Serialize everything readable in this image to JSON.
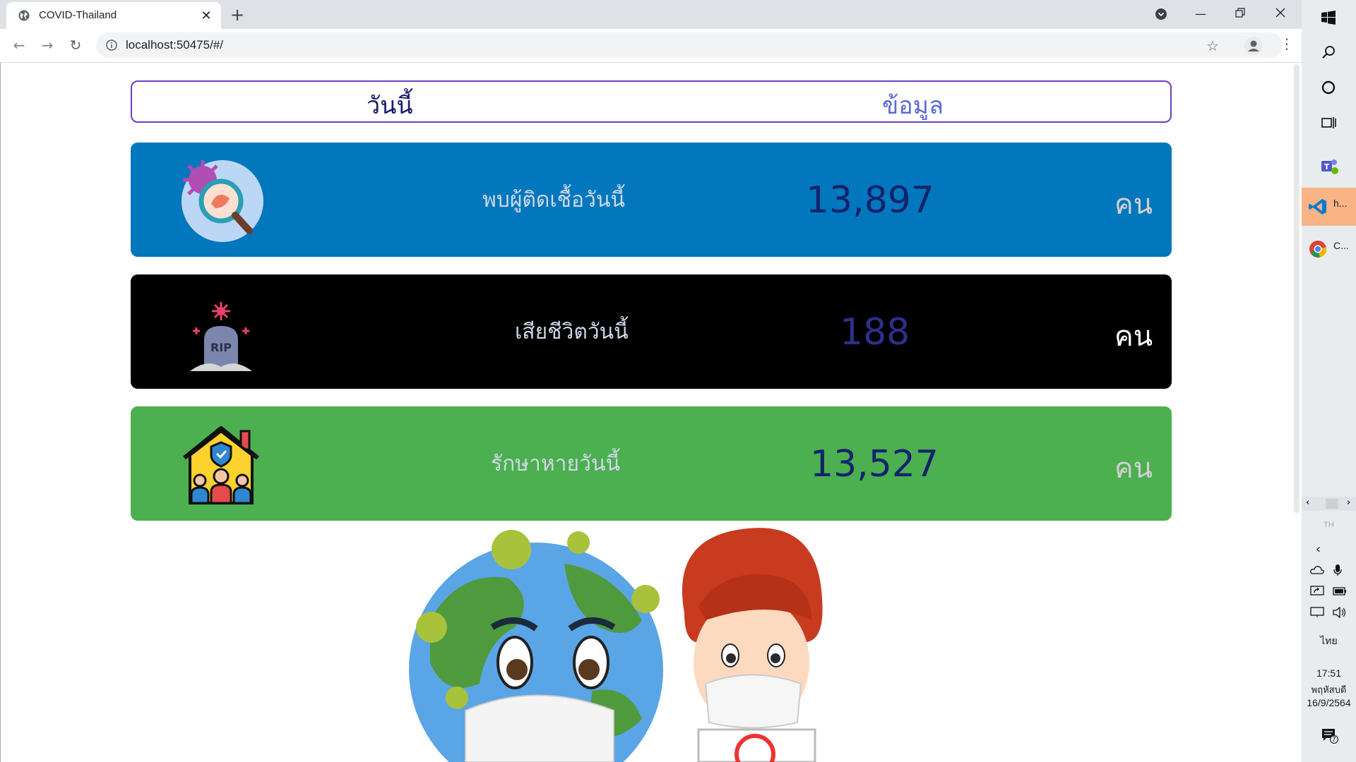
{
  "browser": {
    "tab_title": "COVID-Thailand",
    "new_tab_label": "+",
    "close_label": "✕",
    "url": "localhost:50475/#/"
  },
  "nav": {
    "today_label": "วันนี้",
    "info_label": "ข้อมูล"
  },
  "cards": [
    {
      "label": "พบผู้ติดเชื้อวันนี้",
      "value": "13,897",
      "unit": "คน",
      "bg": "#0277bd",
      "value_color": "#12236b",
      "icon": "virus-magnifier-icon"
    },
    {
      "label": "เสียชีวิตวันนี้",
      "value": "188",
      "unit": "คน",
      "bg": "#000000",
      "value_color": "#2c2f8c",
      "icon": "rip-tombstone-icon"
    },
    {
      "label": "รักษาหายวันนี้",
      "value": "13,527",
      "unit": "คน",
      "bg": "#4caf50",
      "value_color": "#12236b",
      "icon": "family-house-icon"
    }
  ],
  "taskbar": {
    "apps": [
      {
        "icon": "windows-start-icon",
        "label": ""
      },
      {
        "icon": "search-icon",
        "label": ""
      },
      {
        "icon": "cortana-icon",
        "label": ""
      },
      {
        "icon": "task-view-icon",
        "label": ""
      },
      {
        "icon": "teams-icon",
        "label": ""
      },
      {
        "icon": "vscode-icon",
        "label": "h..."
      },
      {
        "icon": "chrome-icon",
        "label": "C..."
      }
    ],
    "lang_small": "TH",
    "lang": "ไทย",
    "time": "17:51",
    "day": "พฤหัสบดี",
    "date": "16/9/2564",
    "notification_count": "7"
  }
}
